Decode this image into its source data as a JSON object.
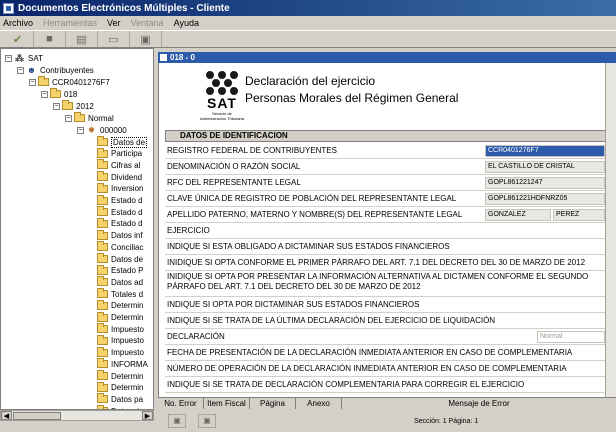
{
  "window": {
    "title": "Documentos Electrónicos Múltiples - Cliente"
  },
  "menu": [
    {
      "label": "Archivo",
      "enabled": true
    },
    {
      "label": "Herramientas",
      "enabled": false
    },
    {
      "label": "Ver",
      "enabled": true
    },
    {
      "label": "Ventana",
      "enabled": false
    },
    {
      "label": "Ayuda",
      "enabled": true
    }
  ],
  "tree": {
    "root": "SAT",
    "contribuyentes": "Contribuyentes",
    "rfc": "CCR0401276F7",
    "form": "018",
    "year": "2012",
    "type": "Normal",
    "period": "000000",
    "leaves": [
      "Datos de",
      "Participa",
      "Cifras al",
      "Dividend",
      "Inversion",
      "Estado d",
      "Estado d",
      "Estado d",
      "Datos inf",
      "Conciliac",
      "Datos de",
      "Estado P",
      "Datos ad",
      "Totales d",
      "Determin",
      "Determin",
      "Impuesto",
      "Impuesto",
      "Impuesto",
      "INFORMA",
      "Determin",
      "Determin",
      "Datos pa",
      "Determin"
    ]
  },
  "document": {
    "tab_label": "018 - 0",
    "logo": {
      "word": "SAT",
      "sub": "Servicio de Administración Tributaria"
    },
    "title_line1": "Declaración del ejercicio",
    "title_line2": "Personas Morales del Régimen General",
    "section": "DATOS DE IDENTIFICACION",
    "fields": [
      {
        "label": "REGISTRO FEDERAL DE CONTRIBUYENTES",
        "value": "CCR0401276F7"
      },
      {
        "label": "DENOMINACIÓN O RAZÓN SOCIAL",
        "value": "EL CASTILLO DE CRISTAL"
      },
      {
        "label": "RFC DEL REPRESENTANTE LEGAL",
        "value": "GOPL861221247"
      },
      {
        "label": "CLAVE ÚNICA DE REGISTRO DE POBLACIÓN DEL REPRESENTANTE LEGAL",
        "value": "GOPL861221HDFNRZ05"
      },
      {
        "label": "APELLIDO PATERNO, MATERNO Y NOMBRE(S) DEL REPRESENTANTE LEGAL",
        "value": "GONZALEZ",
        "value2": "PEREZ"
      },
      {
        "label": "EJERCICIO"
      },
      {
        "label": "INDIQUE SI ESTA OBLIGADO A DICTAMINAR SUS ESTADOS FINANCIEROS"
      },
      {
        "label": "INIDIQUE SI OPTA CONFORME EL PRIMER PÁRRAFO DEL ART. 7.1 DEL DECRETO DEL 30 DE MARZO DE 2012"
      },
      {
        "label": "INIDIQUE SI OPTA POR PRESENTAR LA INFORMACIÓN ALTERNATIVA AL DICTAMEN CONFORME EL SEGUNDO PÁRRAFO DEL ART. 7.1 DEL DECRETO DEL 30 DE MARZO DE 2012"
      },
      {
        "label": "INDIQUE SI OPTA POR DICTAMINAR SUS ESTADOS FINANCIEROS"
      },
      {
        "label": "INDIQUE SI SE TRATA DE LA ÚLTIMA DECLARACIÓN DEL EJERCICIO DE LIQUIDACIÓN"
      },
      {
        "label": "DECLARACIÓN",
        "value": "Normal"
      },
      {
        "label": "FECHA DE PRESENTACIÓN DE LA DECLARACIÓN INMEDIATA ANTERIOR EN CASO DE COMPLEMENTARIA"
      },
      {
        "label": "NÚMERO DE OPERACIÓN DE LA DECLARACIÓN INMEDIATA ANTERIOR EN CASO DE COMPLEMENTARIA"
      },
      {
        "label": "INDIQUE SI SE TRATA DE DECLARACIÓN COMPLEMENTARIA PARA CORREGIR EL EJERCICIO"
      }
    ]
  },
  "errors": {
    "columns": [
      "No. Error",
      "Item Fiscal",
      "Página",
      "Anexo",
      "Mensaje de Error"
    ]
  },
  "status": {
    "text": "Sección: 1  Página: 1"
  }
}
